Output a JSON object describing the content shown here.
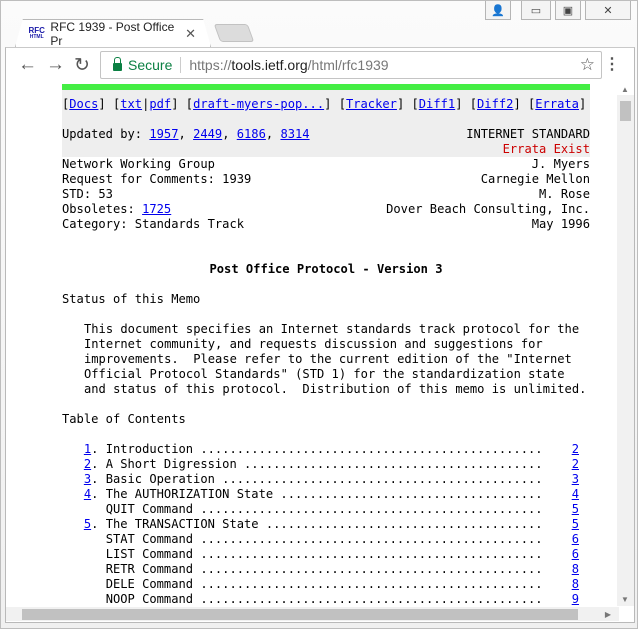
{
  "browser": {
    "tab_title": "RFC 1939 - Post Office Pr",
    "favicon_text_top": "RFC",
    "favicon_text_bottom": "HTML",
    "secure_label": "Secure",
    "url_scheme": "https://",
    "url_host": "tools.ietf.org",
    "url_path": "/html/rfc1939"
  },
  "nav_links": [
    {
      "label": "Docs"
    },
    {
      "label": "txt"
    },
    {
      "label": "pdf"
    },
    {
      "label": "draft-myers-pop..."
    },
    {
      "label": "Tracker"
    },
    {
      "label": "Diff1"
    },
    {
      "label": "Diff2"
    },
    {
      "label": "Errata"
    }
  ],
  "updated_by_label": "Updated by: ",
  "updated_by": [
    "1957",
    "2449",
    "6186",
    "8314"
  ],
  "status": "INTERNET STANDARD",
  "errata": "Errata Exist",
  "header": [
    {
      "left": "Network Working Group",
      "right": "J. Myers"
    },
    {
      "left": "Request for Comments: 1939",
      "right": "Carnegie Mellon"
    },
    {
      "left": "STD: 53",
      "right": "M. Rose"
    },
    {
      "left": "Obsoletes: ",
      "link": "1725",
      "right": "Dover Beach Consulting, Inc."
    },
    {
      "left": "Category: Standards Track",
      "right": "May 1996"
    }
  ],
  "title": "Post Office Protocol - Version 3",
  "status_heading": "Status of this Memo",
  "status_paragraph": [
    "This document specifies an Internet standards track protocol for the",
    "Internet community, and requests discussion and suggestions for",
    "improvements.  Please refer to the current edition of the \"Internet",
    "Official Protocol Standards\" (STD 1) for the standardization state",
    "and status of this protocol.  Distribution of this memo is unlimited."
  ],
  "toc_heading": "Table of Contents",
  "toc": [
    {
      "num": "1",
      "title": "Introduction",
      "page": "2"
    },
    {
      "num": "2",
      "title": "A Short Digression",
      "page": "2"
    },
    {
      "num": "3",
      "title": "Basic Operation",
      "page": "3"
    },
    {
      "num": "4",
      "title": "The AUTHORIZATION State",
      "page": "4"
    },
    {
      "num": "",
      "title": "QUIT Command",
      "page": "5"
    },
    {
      "num": "5",
      "title": "The TRANSACTION State",
      "page": "5"
    },
    {
      "num": "",
      "title": "STAT Command",
      "page": "6"
    },
    {
      "num": "",
      "title": "LIST Command",
      "page": "6"
    },
    {
      "num": "",
      "title": "RETR Command",
      "page": "8"
    },
    {
      "num": "",
      "title": "DELE Command",
      "page": "8"
    },
    {
      "num": "",
      "title": "NOOP Command",
      "page": "9"
    }
  ]
}
